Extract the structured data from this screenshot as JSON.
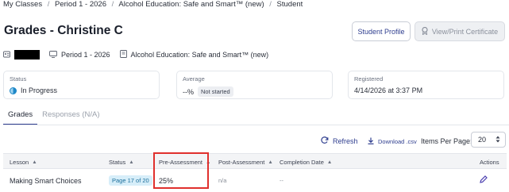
{
  "breadcrumb": {
    "items": [
      "My Classes",
      "Period 1 - 2026",
      "Alcohol Education: Safe and Smart™ (new)",
      "Student"
    ],
    "separator": "/"
  },
  "page": {
    "title": "Grades - Christine C"
  },
  "actions": {
    "student_profile": "Student Profile",
    "view_print_certificate": "View/Print Certificate"
  },
  "meta": {
    "student_id_icon": "id-card-icon",
    "period": "Period 1 - 2026",
    "course": "Alcohol Education: Safe and Smart™ (new)"
  },
  "cards": {
    "status": {
      "label": "Status",
      "value": "In Progress"
    },
    "average": {
      "label": "Average",
      "value": "--%",
      "badge": "Not started"
    },
    "registered": {
      "label": "Registered",
      "value": "4/14/2026 at 3:37 PM"
    }
  },
  "tabs": [
    {
      "label": "Grades",
      "active": true
    },
    {
      "label": "Responses (N/A)",
      "active": false
    }
  ],
  "toolbar": {
    "refresh": "Refresh",
    "download": "Download .csv",
    "items_per_page_label": "Items Per Page:",
    "items_per_page_value": "20"
  },
  "table": {
    "columns": [
      "Lesson",
      "Status",
      "Pre-Assessment",
      "Post-Assessment",
      "Completion Date",
      "Actions"
    ],
    "rows": [
      {
        "lesson": "Making Smart Choices",
        "status": "Page 17 of 20",
        "pre": "25%",
        "post": "n/a",
        "completion": "--"
      }
    ]
  },
  "colors": {
    "accent": "#2f3e8f",
    "highlight": "#e0302d",
    "status_pill_bg": "#d7eef9"
  }
}
